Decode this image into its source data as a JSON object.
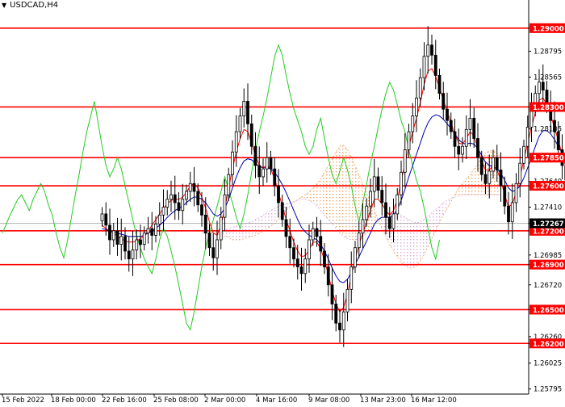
{
  "symbol": "USDCAD,H4",
  "colors": {
    "background": "#ffffff",
    "level_line": "#ff0000",
    "level_badge": "#ff0000",
    "current_badge": "#000000",
    "candle": "#000000",
    "tenkan": "#ff0000",
    "kijun": "#0000b0",
    "chikou": "#22cc22",
    "cloud_bull": "#f4a460",
    "cloud_bear": "#d8a8d8",
    "axis": "#000000",
    "current_line": "#a0a0a0"
  },
  "chart_data": {
    "type": "candlestick",
    "title": "USDCAD,H4",
    "ylim": [
      1.2575,
      1.2925
    ],
    "y_ticks": [
      "1.29000",
      "1.28795",
      "1.28565",
      "1.28300",
      "1.28105",
      "1.27850",
      "1.27640",
      "1.27600",
      "1.27410",
      "1.27267",
      "1.27200",
      "1.26985",
      "1.26900",
      "1.26720",
      "1.26500",
      "1.26260",
      "1.26200",
      "1.26025",
      "1.25795"
    ],
    "x_labels": [
      "15 Feb 2022",
      "18 Feb 00:00",
      "22 Feb 16:00",
      "25 Feb 08:00",
      "2 Mar 00:00",
      "4 Mar 16:00",
      "9 Mar 08:00",
      "13 Mar 23:00",
      "16 Mar 12:00"
    ],
    "levels": [
      1.29,
      1.283,
      1.2785,
      1.276,
      1.272,
      1.269,
      1.265,
      1.262
    ],
    "current_price": 1.27267,
    "current_price_label": "1.27267",
    "candles_close": [
      1.2735,
      1.2725,
      1.2712,
      1.272,
      1.2708,
      1.2715,
      1.2702,
      1.2695,
      1.2703,
      1.2712,
      1.2708,
      1.2718,
      1.2722,
      1.2716,
      1.2726,
      1.2734,
      1.2741,
      1.2748,
      1.2752,
      1.2745,
      1.2738,
      1.2748,
      1.2755,
      1.2762,
      1.2755,
      1.2743,
      1.2734,
      1.2718,
      1.2705,
      1.2696,
      1.2712,
      1.2732,
      1.2752,
      1.277,
      1.279,
      1.2808,
      1.2822,
      1.2835,
      1.2815,
      1.2795,
      1.2778,
      1.2768,
      1.2775,
      1.2785,
      1.2775,
      1.276,
      1.2745,
      1.273,
      1.2715,
      1.2705,
      1.2695,
      1.2688,
      1.2682,
      1.2695,
      1.2712,
      1.2722,
      1.2715,
      1.2702,
      1.2688,
      1.2672,
      1.2655,
      1.2638,
      1.2632,
      1.2648,
      1.2668,
      1.2688,
      1.2705,
      1.2718,
      1.273,
      1.2742,
      1.2755,
      1.2768,
      1.2756,
      1.2745,
      1.2732,
      1.2722,
      1.2735,
      1.2752,
      1.2772,
      1.2792,
      1.2808,
      1.2822,
      1.2838,
      1.2856,
      1.2875,
      1.2885,
      1.2876,
      1.2858,
      1.2842,
      1.2828,
      1.2818,
      1.2808,
      1.2795,
      1.2788,
      1.2795,
      1.281,
      1.282,
      1.2802,
      1.2785,
      1.277,
      1.2762,
      1.2773,
      1.2785,
      1.2774,
      1.276,
      1.2742,
      1.2728,
      1.2745,
      1.2762,
      1.278,
      1.2795,
      1.2812,
      1.2828,
      1.2842,
      1.2852,
      1.2845,
      1.2832,
      1.2818,
      1.2808,
      1.2792,
      1.2778,
      1.2765,
      1.2755,
      1.274,
      1.2722,
      1.2705,
      1.2695,
      1.2712
    ],
    "tenkan": [
      1.2725,
      1.2722,
      1.272,
      1.2718,
      1.2715,
      1.2713,
      1.2711,
      1.271,
      1.271,
      1.2711,
      1.2713,
      1.2716,
      1.272,
      1.2725,
      1.273,
      1.2735,
      1.274,
      1.2744,
      1.2747,
      1.2748,
      1.2748,
      1.275,
      1.2754,
      1.276,
      1.2762,
      1.2758,
      1.275,
      1.274,
      1.2728,
      1.2718,
      1.2716,
      1.2725,
      1.274,
      1.2758,
      1.2775,
      1.279,
      1.2802,
      1.281,
      1.2808,
      1.2798,
      1.2787,
      1.2778,
      1.2776,
      1.2778,
      1.2775,
      1.2766,
      1.2754,
      1.2742,
      1.273,
      1.272,
      1.271,
      1.2702,
      1.2697,
      1.2698,
      1.2703,
      1.271,
      1.271,
      1.2704,
      1.2694,
      1.2681,
      1.2667,
      1.2655,
      1.2648,
      1.2652,
      1.2664,
      1.268,
      1.2695,
      1.2708,
      1.2718,
      1.2728,
      1.2738,
      1.2748,
      1.2748,
      1.2744,
      1.2738,
      1.2734,
      1.2738,
      1.2748,
      1.2764,
      1.278,
      1.2795,
      1.2808,
      1.282,
      1.2834,
      1.285,
      1.2862,
      1.2864,
      1.2857,
      1.2847,
      1.2836,
      1.2826,
      1.2816,
      1.2806,
      1.2798,
      1.2797,
      1.2802,
      1.2808,
      1.2804,
      1.2793,
      1.2782,
      1.2774,
      1.2774,
      1.2778,
      1.2774,
      1.2765,
      1.2752,
      1.2741,
      1.2744,
      1.2754,
      1.2768,
      1.2783,
      1.2798,
      1.2812,
      1.2825,
      1.2836,
      1.2838,
      1.2832,
      1.2822,
      1.2812,
      1.28,
      1.2788,
      1.2776,
      1.2765,
      1.2752,
      1.2737,
      1.272,
      1.2708,
      1.2705
    ],
    "kijun": [
      1.2722,
      1.2721,
      1.272,
      1.2719,
      1.2718,
      1.2717,
      1.2716,
      1.2715,
      1.2715,
      1.2715,
      1.2715,
      1.2716,
      1.2718,
      1.272,
      1.2722,
      1.2725,
      1.2728,
      1.2732,
      1.2735,
      1.2738,
      1.274,
      1.2742,
      1.2745,
      1.2748,
      1.275,
      1.275,
      1.2748,
      1.2745,
      1.274,
      1.2735,
      1.2733,
      1.2735,
      1.274,
      1.2748,
      1.2758,
      1.2768,
      1.2776,
      1.2782,
      1.2784,
      1.2783,
      1.278,
      1.2777,
      1.2776,
      1.2776,
      1.2775,
      1.2772,
      1.2767,
      1.2761,
      1.2754,
      1.2746,
      1.2738,
      1.273,
      1.2723,
      1.2719,
      1.2716,
      1.2714,
      1.2712,
      1.2708,
      1.2702,
      1.2695,
      1.2687,
      1.268,
      1.2675,
      1.2674,
      1.2677,
      1.2683,
      1.269,
      1.2697,
      1.2704,
      1.2711,
      1.2718,
      1.2726,
      1.273,
      1.2732,
      1.2732,
      1.2732,
      1.2734,
      1.2739,
      1.2747,
      1.2757,
      1.2768,
      1.2778,
      1.2788,
      1.2798,
      1.2808,
      1.2816,
      1.2821,
      1.2823,
      1.2822,
      1.2819,
      1.2815,
      1.2811,
      1.2806,
      1.2801,
      1.2798,
      1.2797,
      1.2798,
      1.2797,
      1.2793,
      1.2787,
      1.2781,
      1.2778,
      1.2777,
      1.2775,
      1.2771,
      1.2765,
      1.2758,
      1.2755,
      1.2756,
      1.276,
      1.2767,
      1.2776,
      1.2785,
      1.2795,
      1.2804,
      1.2809,
      1.2809,
      1.2806,
      1.2801,
      1.2795,
      1.2789,
      1.2782,
      1.2775,
      1.2768,
      1.276,
      1.2751,
      1.2744,
      1.2738
    ],
    "chikou": [
      1.2718,
      1.2726,
      1.2734,
      1.2741,
      1.2748,
      1.2752,
      1.2745,
      1.2738,
      1.2748,
      1.2755,
      1.2762,
      1.2755,
      1.2743,
      1.2734,
      1.2718,
      1.2705,
      1.2696,
      1.2712,
      1.2732,
      1.2752,
      1.277,
      1.279,
      1.2808,
      1.2822,
      1.2835,
      1.2815,
      1.2795,
      1.2778,
      1.2768,
      1.2775,
      1.2785,
      1.2775,
      1.276,
      1.2745,
      1.273,
      1.2715,
      1.2705,
      1.2695,
      1.2688,
      1.2682,
      1.2695,
      1.2712,
      1.2722,
      1.2715,
      1.2702,
      1.2688,
      1.2672,
      1.2655,
      1.2638,
      1.2632,
      1.2648,
      1.2668,
      1.2688,
      1.2705,
      1.2718,
      1.273,
      1.2742,
      1.2755,
      1.2768,
      1.2756,
      1.2745,
      1.2732,
      1.2722,
      1.2735,
      1.2752,
      1.2772,
      1.2792,
      1.2808,
      1.2822,
      1.2838,
      1.2856,
      1.2875,
      1.2885,
      1.2876,
      1.2858,
      1.2842,
      1.2828,
      1.2818,
      1.2808,
      1.2795,
      1.2788,
      1.2795,
      1.281,
      1.282,
      1.2802,
      1.2785,
      1.277,
      1.2762,
      1.2773,
      1.2785,
      1.2774,
      1.276,
      1.2742,
      1.2728,
      1.2745,
      1.2762,
      1.278,
      1.2795,
      1.2812,
      1.2828,
      1.2842,
      1.2852,
      1.2845,
      1.2832,
      1.2818,
      1.2808,
      1.2792,
      1.2778,
      1.2765,
      1.2755,
      1.274,
      1.2722,
      1.2705,
      1.2695,
      1.2712
    ]
  },
  "cloud": {
    "span_a": [
      1.272,
      1.272,
      1.2719,
      1.2718,
      1.2717,
      1.2716,
      1.2715,
      1.2714,
      1.2712,
      1.2712,
      1.2712,
      1.2713,
      1.2714,
      1.2715,
      1.2716,
      1.2718,
      1.272,
      1.2722,
      1.2724,
      1.2727,
      1.273,
      1.2734,
      1.2738,
      1.2742,
      1.2745,
      1.2748,
      1.275,
      1.2752,
      1.2755,
      1.2758,
      1.2762,
      1.2766,
      1.2772,
      1.2778,
      1.2784,
      1.279,
      1.2795,
      1.2796,
      1.2792,
      1.2786,
      1.2778,
      1.277,
      1.2762,
      1.2754,
      1.2746,
      1.2738,
      1.273,
      1.2722,
      1.2715,
      1.2708,
      1.2702,
      1.2697,
      1.2692,
      1.2689,
      1.2687,
      1.2687,
      1.2689,
      1.2693,
      1.2699,
      1.2706,
      1.2713,
      1.272,
      1.2727,
      1.2734,
      1.274,
      1.2746,
      1.2752,
      1.2758,
      1.2762,
      1.2766,
      1.277,
      1.2775,
      1.278,
      1.2785,
      1.2789,
      1.2791,
      1.2791,
      1.2789,
      1.2786
    ],
    "span_b": [
      1.2718,
      1.2718,
      1.2718,
      1.2718,
      1.2719,
      1.272,
      1.2721,
      1.2722,
      1.2723,
      1.2724,
      1.2725,
      1.2726,
      1.2727,
      1.2728,
      1.273,
      1.2732,
      1.2734,
      1.2736,
      1.2738,
      1.274,
      1.2742,
      1.2743,
      1.2744,
      1.2745,
      1.2746,
      1.2747,
      1.2748,
      1.2748,
      1.2747,
      1.2745,
      1.2742,
      1.2738,
      1.2734,
      1.273,
      1.2726,
      1.2722,
      1.2718,
      1.2715,
      1.2713,
      1.2712,
      1.2712,
      1.2713,
      1.2715,
      1.2718,
      1.2722,
      1.2726,
      1.273,
      1.2733,
      1.2735,
      1.2736,
      1.2736,
      1.2735,
      1.2734,
      1.2732,
      1.273,
      1.2728,
      1.2727,
      1.2728,
      1.273,
      1.2733,
      1.2736,
      1.2739,
      1.2742,
      1.2745,
      1.2747,
      1.2749,
      1.275,
      1.2751,
      1.2752,
      1.2752,
      1.2752,
      1.2752,
      1.2752,
      1.2752,
      1.2752,
      1.2752,
      1.2752,
      1.2752,
      1.2752
    ]
  }
}
